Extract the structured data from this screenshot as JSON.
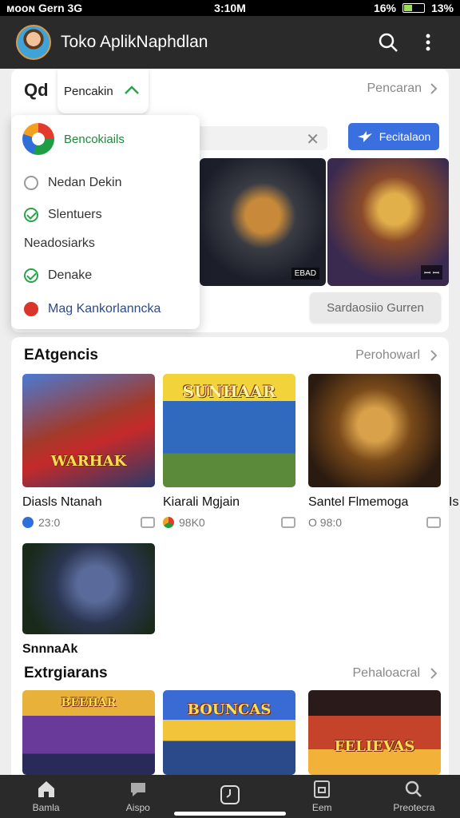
{
  "status": {
    "left": "ᴍᴏᴏɴ Gern 3G",
    "time": "3:10M",
    "battery": "16%",
    "signal": "13%"
  },
  "appbar": {
    "title": "Toko AplikNaphdlan"
  },
  "filter": {
    "search_label": "Qd",
    "tab_label": "Pencakin",
    "right_link": "Pencaran"
  },
  "dropdown": {
    "header": "Bencokiails",
    "items": [
      {
        "label": "Nedan Dekin",
        "state": "empty"
      },
      {
        "label": "Slentuers",
        "state": "checked"
      },
      {
        "label": "Neadosiarks",
        "state": "none"
      },
      {
        "label": "Denake",
        "state": "checked"
      },
      {
        "label": "Mag Kankorlanncka",
        "state": "red"
      }
    ]
  },
  "search": {
    "placeholder": ""
  },
  "buttons": {
    "blue": "Fecitalaon",
    "gray": "Sardaosiio Gurren"
  },
  "hero": {
    "tag1": "EBAD",
    "tag2": "ꟷ ꟷ"
  },
  "section1": {
    "title": "EAtgencis",
    "link": "Perohowarl",
    "games": [
      {
        "name": "Diasls Ntanah",
        "rating": "23:0",
        "thumb_text": "WARHAK",
        "dot_color": "#2f6fd9"
      },
      {
        "name": "Kiarali Mgjain",
        "rating": "98K0",
        "thumb_text": "SUNHAAR",
        "dot_color": "#e23b2e"
      },
      {
        "name": "Santel Flmemoga",
        "rating": "O 98:0",
        "thumb_text": "",
        "dot_color": "#ffffff"
      }
    ],
    "clip_text": "Is",
    "extra_game": {
      "name": "SnnnaAk"
    }
  },
  "section2": {
    "title": "Extrgiarans",
    "link": "Pehaloacral",
    "games": [
      {
        "thumb_text": "BEEHAR"
      },
      {
        "thumb_text": "BOUNCAS"
      },
      {
        "thumb_text": "FELIEVAS"
      }
    ]
  },
  "nav": [
    {
      "label": "Bamla",
      "icon": "home-icon"
    },
    {
      "label": "Aispo",
      "icon": "chat-icon"
    },
    {
      "label": "",
      "icon": "clock-icon"
    },
    {
      "label": "Eem",
      "icon": "tablet-icon"
    },
    {
      "label": "Preotecra",
      "icon": "search-icon"
    }
  ]
}
